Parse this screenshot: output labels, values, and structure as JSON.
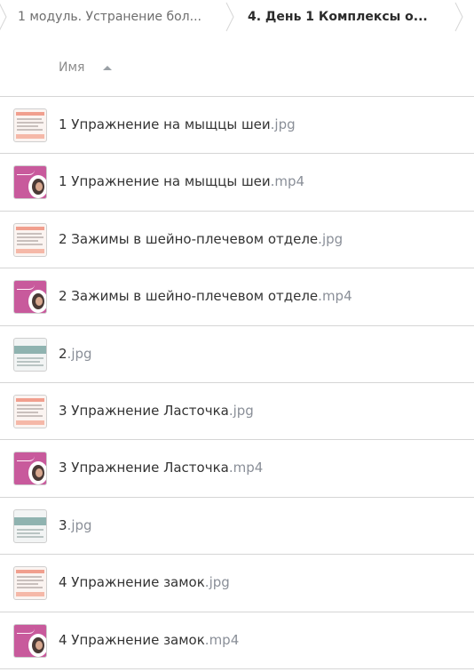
{
  "breadcrumbs": [
    {
      "label": "1 модуль. Устранение бол..."
    },
    {
      "label": "4. День 1 Комплексы о..."
    }
  ],
  "header": {
    "name_label": "Имя",
    "sort_icon": "sort-ascending-icon"
  },
  "files": [
    {
      "name": "1 Упражнение на мыщцы шеи",
      "ext": ".jpg",
      "thumb": "doc"
    },
    {
      "name": "1 Упражнение на мыщцы шеи",
      "ext": ".mp4",
      "thumb": "video"
    },
    {
      "name": "2 Зажимы в шейно-плечевом отделе",
      "ext": ".jpg",
      "thumb": "doc"
    },
    {
      "name": "2 Зажимы в шейно-плечевом отделе",
      "ext": ".mp4",
      "thumb": "video"
    },
    {
      "name": "2",
      "ext": ".jpg",
      "thumb": "teal"
    },
    {
      "name": "3 Упражнение Ласточка",
      "ext": ".jpg",
      "thumb": "doc"
    },
    {
      "name": "3 Упражнение Ласточка",
      "ext": ".mp4",
      "thumb": "video"
    },
    {
      "name": "3",
      "ext": ".jpg",
      "thumb": "teal"
    },
    {
      "name": "4 Упражнение замок",
      "ext": ".jpg",
      "thumb": "doc"
    },
    {
      "name": "4 Упражнение замок",
      "ext": ".mp4",
      "thumb": "video"
    }
  ],
  "colors": {
    "divider": "#d5d5d5",
    "extension": "#8a8f98",
    "text": "#333333"
  }
}
